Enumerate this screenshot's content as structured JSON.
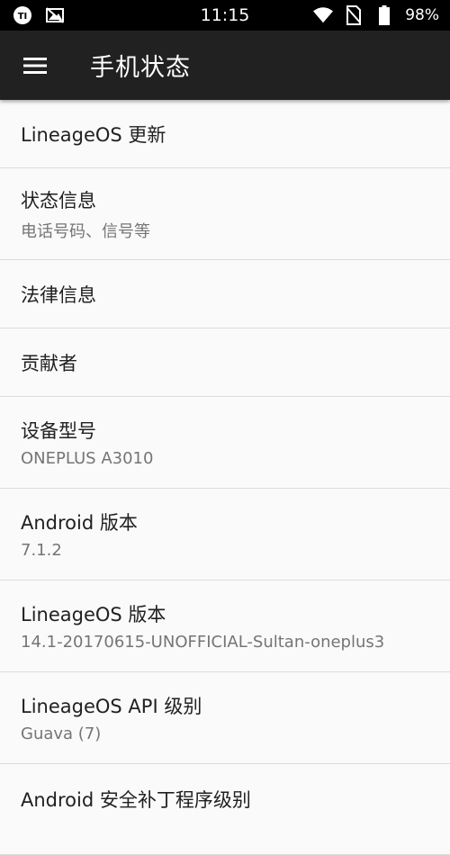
{
  "status_bar": {
    "time": "11:15",
    "battery": "98%"
  },
  "app_bar": {
    "title": "手机状态"
  },
  "items": [
    {
      "title": "LineageOS 更新",
      "summary": ""
    },
    {
      "title": "状态信息",
      "summary": "电话号码、信号等"
    },
    {
      "title": "法律信息",
      "summary": ""
    },
    {
      "title": "贡献者",
      "summary": ""
    },
    {
      "title": "设备型号",
      "summary": "ONEPLUS A3010"
    },
    {
      "title": "Android 版本",
      "summary": "7.1.2"
    },
    {
      "title": "LineageOS 版本",
      "summary": "14.1-20170615-UNOFFICIAL-Sultan-oneplus3"
    },
    {
      "title": "LineageOS API 级别",
      "summary": "Guava (7)"
    },
    {
      "title": "Android 安全补丁程序级别",
      "summary": ""
    }
  ],
  "colors": {
    "status_bar": "#000000",
    "app_bar": "#212121",
    "background": "#fafafa",
    "divider": "#dcdcdc"
  }
}
